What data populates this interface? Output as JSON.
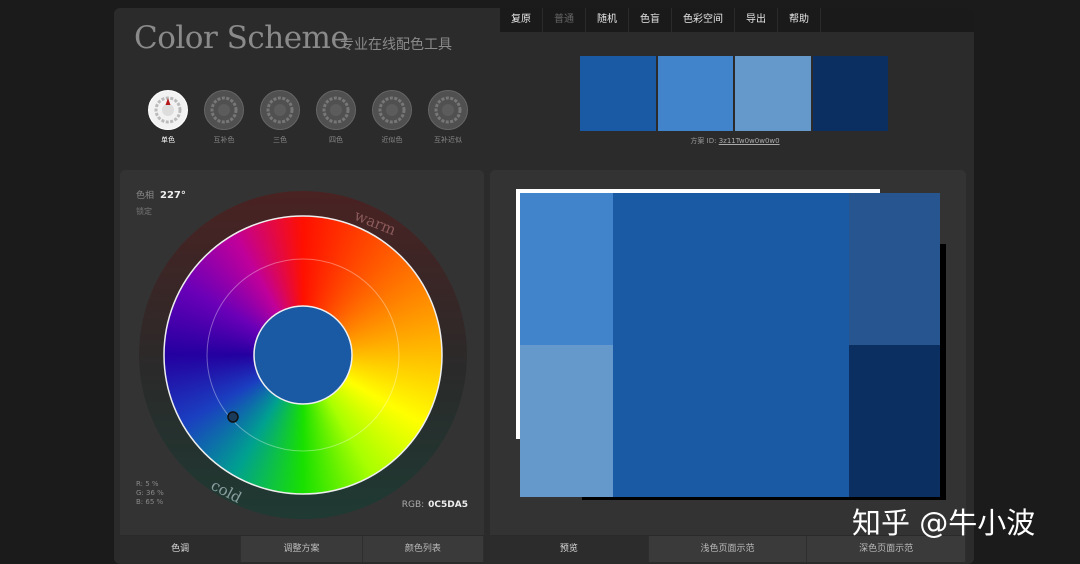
{
  "menu": {
    "items": [
      "复原",
      "普通",
      "随机",
      "色盲",
      "色彩空间",
      "导出",
      "帮助"
    ],
    "disabled_index": 1
  },
  "logo": {
    "title": "Color Scheme",
    "subtitle": "专业在线配色工具"
  },
  "modes": [
    {
      "label": "单色",
      "active": true
    },
    {
      "label": "互补色",
      "active": false
    },
    {
      "label": "三色",
      "active": false
    },
    {
      "label": "四色",
      "active": false
    },
    {
      "label": "近似色",
      "active": false
    },
    {
      "label": "互补近似",
      "active": false
    }
  ],
  "palette": [
    "#1a5aa4",
    "#4284cc",
    "#6599cc",
    "#0b2f60"
  ],
  "scheme_id": {
    "label": "方案 ID:",
    "value": "3z11Tw0w0w0w0"
  },
  "hue": {
    "label": "色相",
    "value": "227°",
    "sub": "锁定"
  },
  "wheel": {
    "warm_label": "warm",
    "cold_label": "cold",
    "center_color": "#1a5aa4"
  },
  "rgb": {
    "lines": [
      "R: 5 %",
      "G: 36 %",
      "B: 65 %"
    ],
    "hex_label": "RGB:",
    "hex_value": "0C5DA5"
  },
  "left_tabs": [
    "色调",
    "调整方案",
    "颜色列表"
  ],
  "right_tabs": [
    "预览",
    "浅色页面示范",
    "深色页面示范"
  ],
  "watermark": "知乎 @牛小波"
}
